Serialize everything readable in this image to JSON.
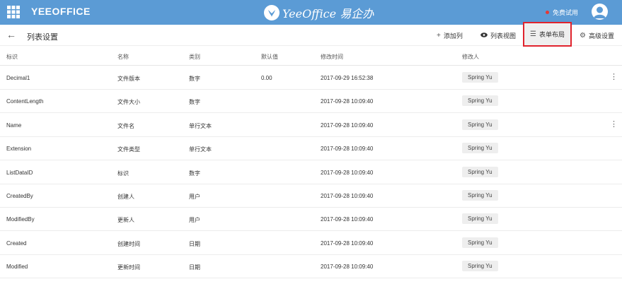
{
  "topbar": {
    "app_name": "YEEOFFICE",
    "brand_name": "YeeOffice 易企办",
    "trial_label": "免费试用",
    "color": "#5b9bd5"
  },
  "toolbar": {
    "back_icon": "arrow-left-icon",
    "title": "列表设置",
    "add_column": "添加列",
    "list_view": "列表视图",
    "form_layout": "表单布局",
    "advanced": "高级设置"
  },
  "table": {
    "headers": [
      "标识",
      "名称",
      "类别",
      "默认值",
      "修改时间",
      "修改人"
    ],
    "rows": [
      {
        "id": "Decimal1",
        "name": "文件版本",
        "type": "数字",
        "default": "0.00",
        "modified": "2017-09-29 16:52:38",
        "by": "Spring Yu",
        "more": true
      },
      {
        "id": "ContentLength",
        "name": "文件大小",
        "type": "数字",
        "default": "",
        "modified": "2017-09-28 10:09:40",
        "by": "Spring Yu",
        "more": false
      },
      {
        "id": "Name",
        "name": "文件名",
        "type": "单行文本",
        "default": "",
        "modified": "2017-09-28 10:09:40",
        "by": "Spring Yu",
        "more": true
      },
      {
        "id": "Extension",
        "name": "文件类型",
        "type": "单行文本",
        "default": "",
        "modified": "2017-09-28 10:09:40",
        "by": "Spring Yu",
        "more": false
      },
      {
        "id": "ListDataID",
        "name": "标识",
        "type": "数字",
        "default": "",
        "modified": "2017-09-28 10:09:40",
        "by": "Spring Yu",
        "more": false
      },
      {
        "id": "CreatedBy",
        "name": "创建人",
        "type": "用户",
        "default": "",
        "modified": "2017-09-28 10:09:40",
        "by": "Spring Yu",
        "more": false
      },
      {
        "id": "ModifiedBy",
        "name": "更新人",
        "type": "用户",
        "default": "",
        "modified": "2017-09-28 10:09:40",
        "by": "Spring Yu",
        "more": false
      },
      {
        "id": "Created",
        "name": "创建时间",
        "type": "日期",
        "default": "",
        "modified": "2017-09-28 10:09:40",
        "by": "Spring Yu",
        "more": false
      },
      {
        "id": "Modified",
        "name": "更新时间",
        "type": "日期",
        "default": "",
        "modified": "2017-09-28 10:09:40",
        "by": "Spring Yu",
        "more": false
      }
    ]
  },
  "highlight_color": "#e0232d"
}
